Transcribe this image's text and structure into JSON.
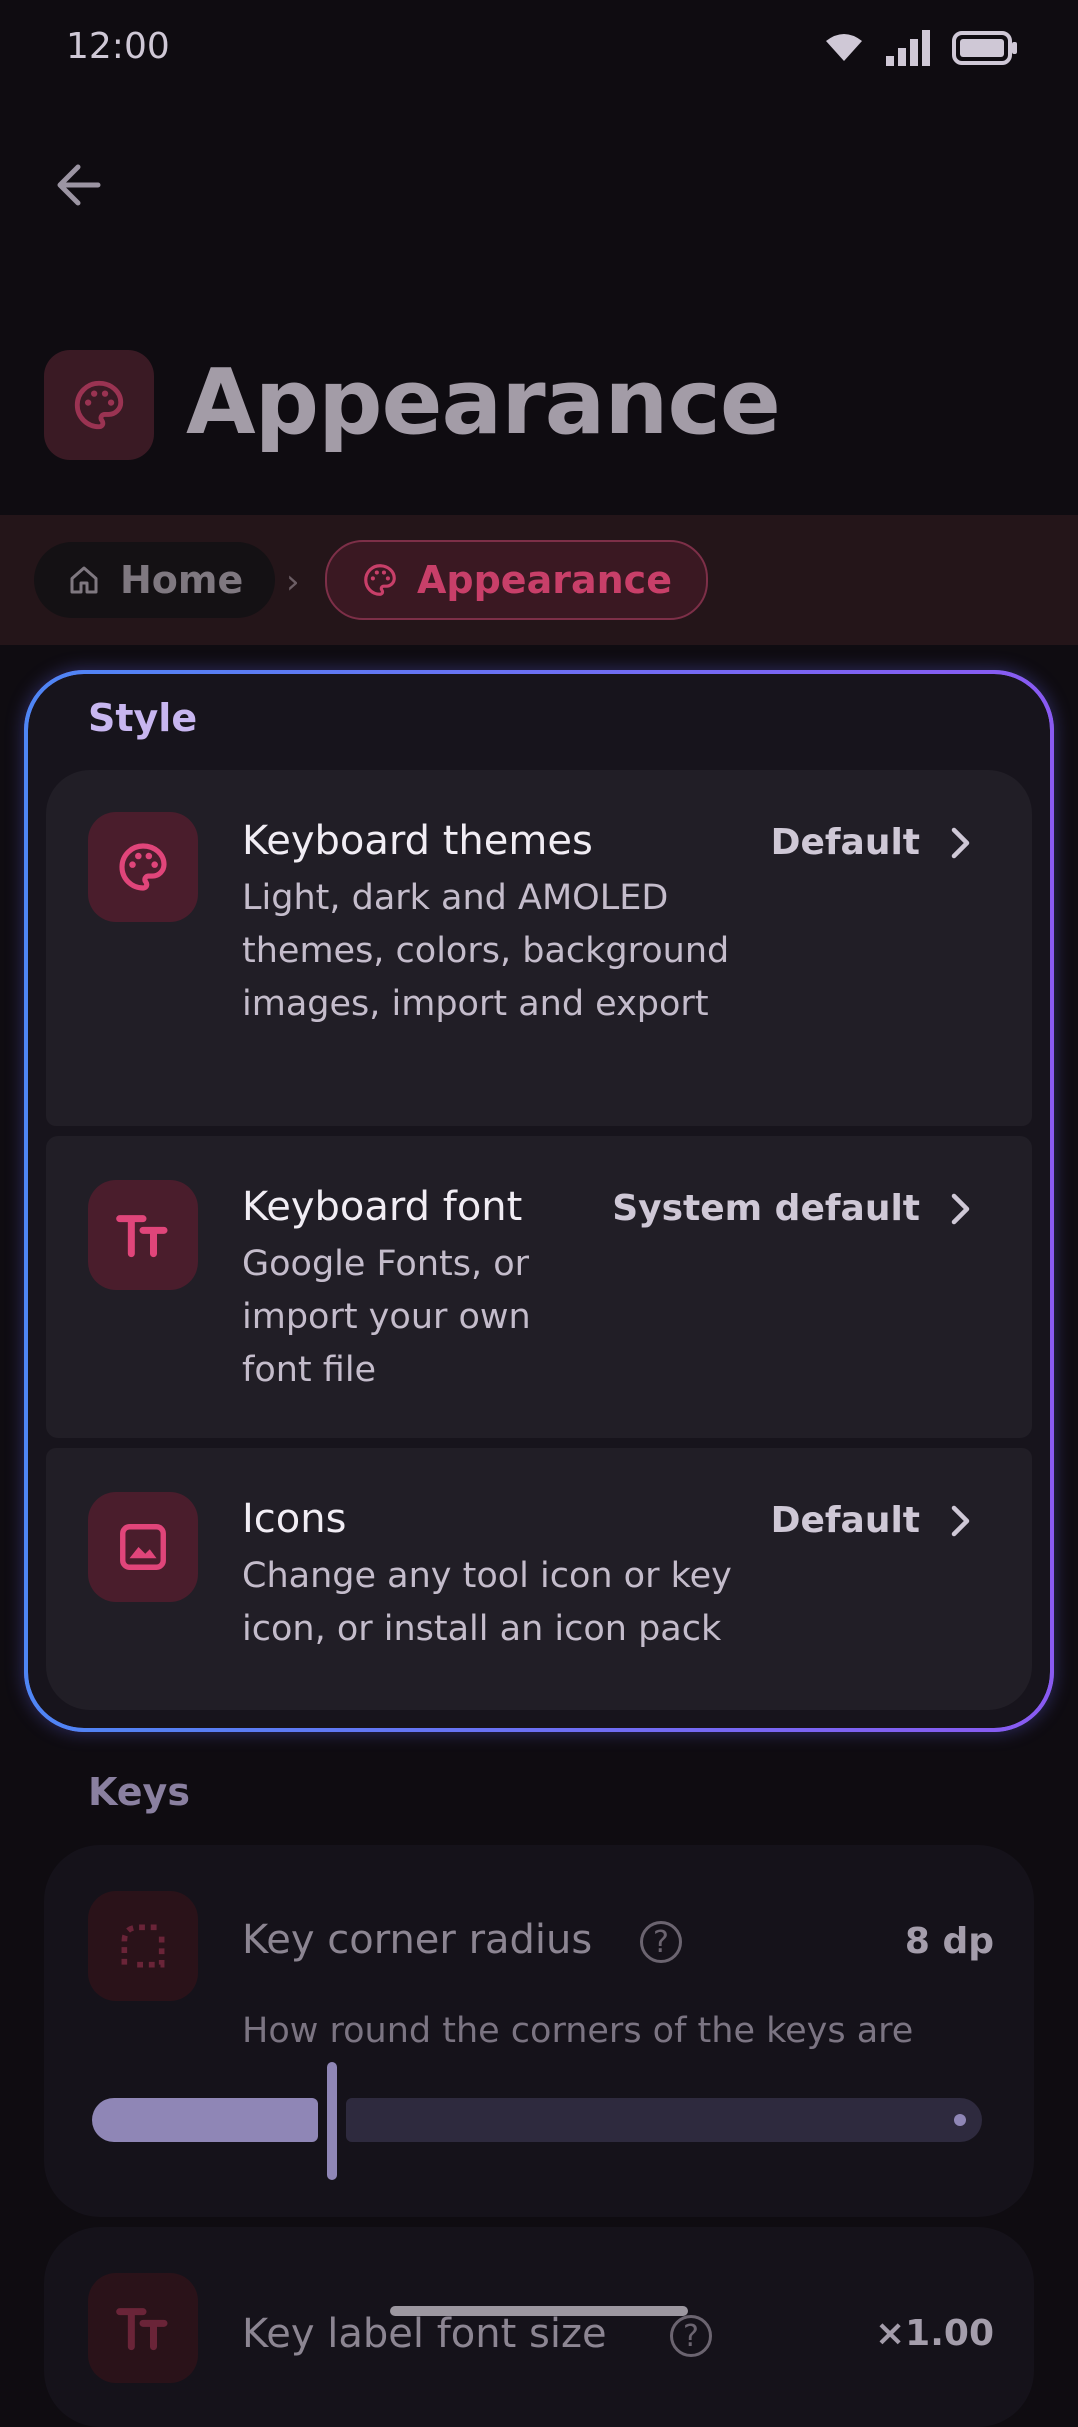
{
  "status": {
    "time": "12:00"
  },
  "header": {
    "title": "Appearance"
  },
  "breadcrumb": {
    "home": "Home",
    "separator": "›",
    "current": "Appearance"
  },
  "style_section": {
    "label": "Style",
    "items": [
      {
        "title": "Keyboard themes",
        "description": "Light, dark and AMOLED themes, colors, background images, import and export",
        "value": "Default",
        "icon": "palette-icon"
      },
      {
        "title": "Keyboard font",
        "description": "Google Fonts, or import your own font file",
        "value": "System default",
        "icon": "text-size-icon"
      },
      {
        "title": "Icons",
        "description": "Change any tool icon or key icon, or install an icon pack",
        "value": "Default",
        "icon": "image-icon"
      }
    ]
  },
  "keys_section": {
    "label": "Keys",
    "corner_radius": {
      "title": "Key corner radius",
      "help": "?",
      "value": "8 dp",
      "description": "How round the corners of the keys are",
      "slider_fraction": 0.27
    },
    "label_font_size": {
      "title": "Key label font size",
      "help": "?",
      "value": "×1.00"
    }
  },
  "colors": {
    "accent": "#e0457a",
    "style_border_start": "#4e86f5",
    "style_border_end": "#8a5af2"
  }
}
